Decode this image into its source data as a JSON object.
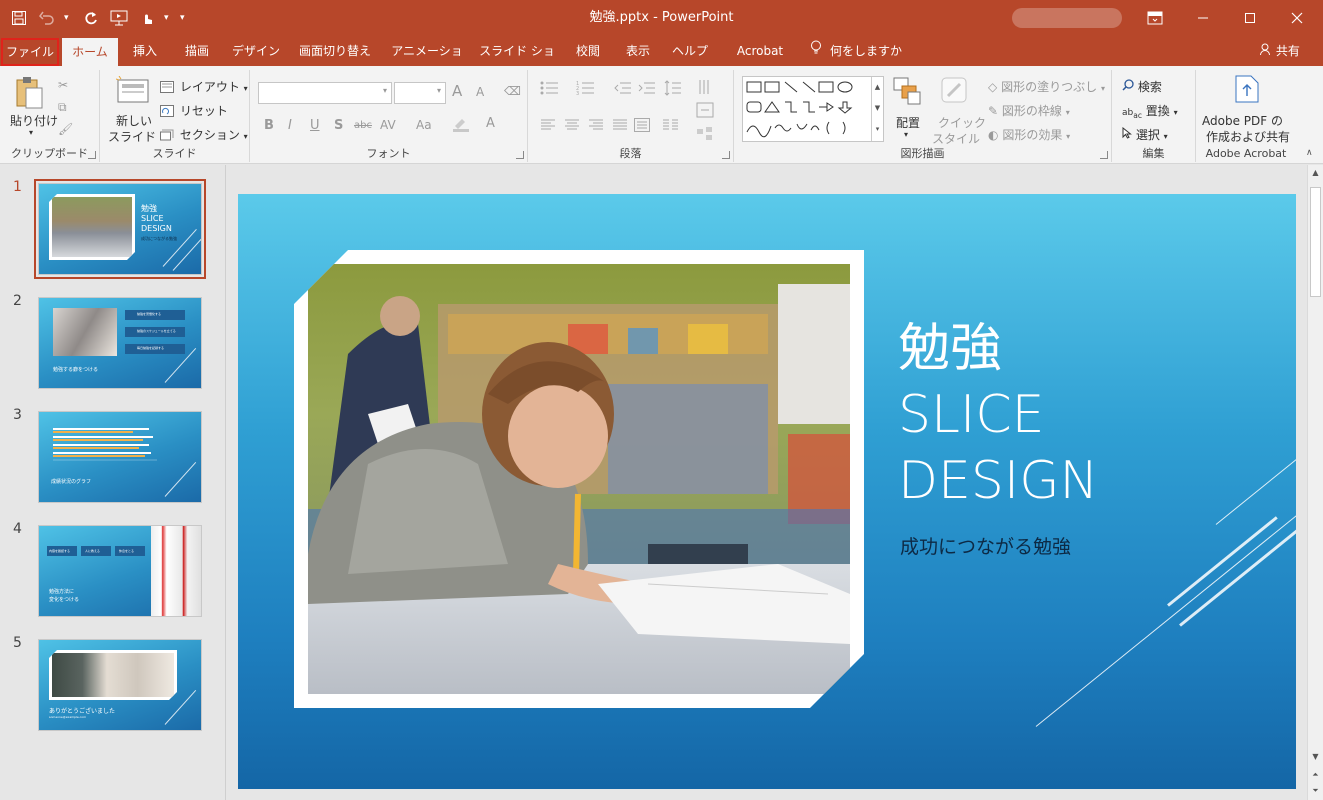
{
  "window": {
    "title": "勉強.pptx  -  PowerPoint",
    "quick_access": [
      "save-icon",
      "undo-icon",
      "redo-icon",
      "slideshow-icon",
      "touch-mode-icon"
    ],
    "controls": {
      "ribbon_display": "ribbon-display-icon",
      "minimize": "minimize-icon",
      "maximize": "maximize-icon",
      "close": "close-icon"
    }
  },
  "tabs": {
    "file": "ファイル",
    "home": "ホーム",
    "insert": "挿入",
    "draw": "描画",
    "design": "デザイン",
    "transitions": "画面切り替え",
    "animations": "アニメーション",
    "slideshow": "スライド ショー",
    "review": "校閲",
    "view": "表示",
    "help": "ヘルプ",
    "acrobat": "Acrobat",
    "tell_me": "何をしますか",
    "share": "共有"
  },
  "ribbon": {
    "clipboard": {
      "label": "クリップボード",
      "paste": "貼り付け"
    },
    "slides": {
      "label": "スライド",
      "new_slide_1": "新しい",
      "new_slide_2": "スライド",
      "layout": "レイアウト",
      "reset": "リセット",
      "section": "セクション"
    },
    "font": {
      "label": "フォント",
      "bold": "B",
      "italic": "I",
      "underline": "U",
      "shadow": "S",
      "strike": "abc",
      "spacing": "AV",
      "case": "Aa",
      "grow": "A",
      "shrink": "A"
    },
    "paragraph": {
      "label": "段落"
    },
    "drawing": {
      "label": "図形描画",
      "arrange": "配置",
      "quick_styles_1": "クイック",
      "quick_styles_2": "スタイル",
      "fill": "図形の塗りつぶし",
      "outline": "図形の枠線",
      "effects": "図形の効果"
    },
    "editing": {
      "label": "編集",
      "find": "検索",
      "replace": "置換",
      "select": "選択"
    },
    "acrobat": {
      "label": "Adobe Acrobat",
      "create_1": "Adobe PDF の",
      "create_2": "作成および共有"
    }
  },
  "slides_pane": {
    "numbers": [
      "1",
      "2",
      "3",
      "4",
      "5"
    ],
    "thumb1": {
      "title_1": "勉強",
      "title_2": "SLICE",
      "title_3": "DESIGN",
      "sub": "成功につながる勉強"
    },
    "thumb2": {
      "caption": "勉強する癖をつける",
      "items": [
        "勉強を習慣化する",
        "勉強のスケジュールを立てる",
        "毎日勉強を記録する"
      ]
    },
    "thumb3": {
      "caption": "成績状況のグラフ"
    },
    "thumb4": {
      "caption_1": "勉強方法に",
      "caption_2": "変化をつける",
      "boxes": [
        "内容を確認する",
        "人に教える",
        "休息をとる"
      ]
    },
    "thumb5": {
      "caption": "ありがとうございました",
      "email": "someone@example.com"
    }
  },
  "slide": {
    "title_line1": "勉強",
    "title_line2": "SLICE",
    "title_line3": "DESIGN",
    "subtitle": "成功につながる勉強"
  },
  "colors": {
    "accent": "#b7472a",
    "ribbon_bg": "#f3f3f3",
    "slide_top": "#5bcaea",
    "slide_bottom": "#1466a6",
    "file_outline": "#e0231b"
  }
}
